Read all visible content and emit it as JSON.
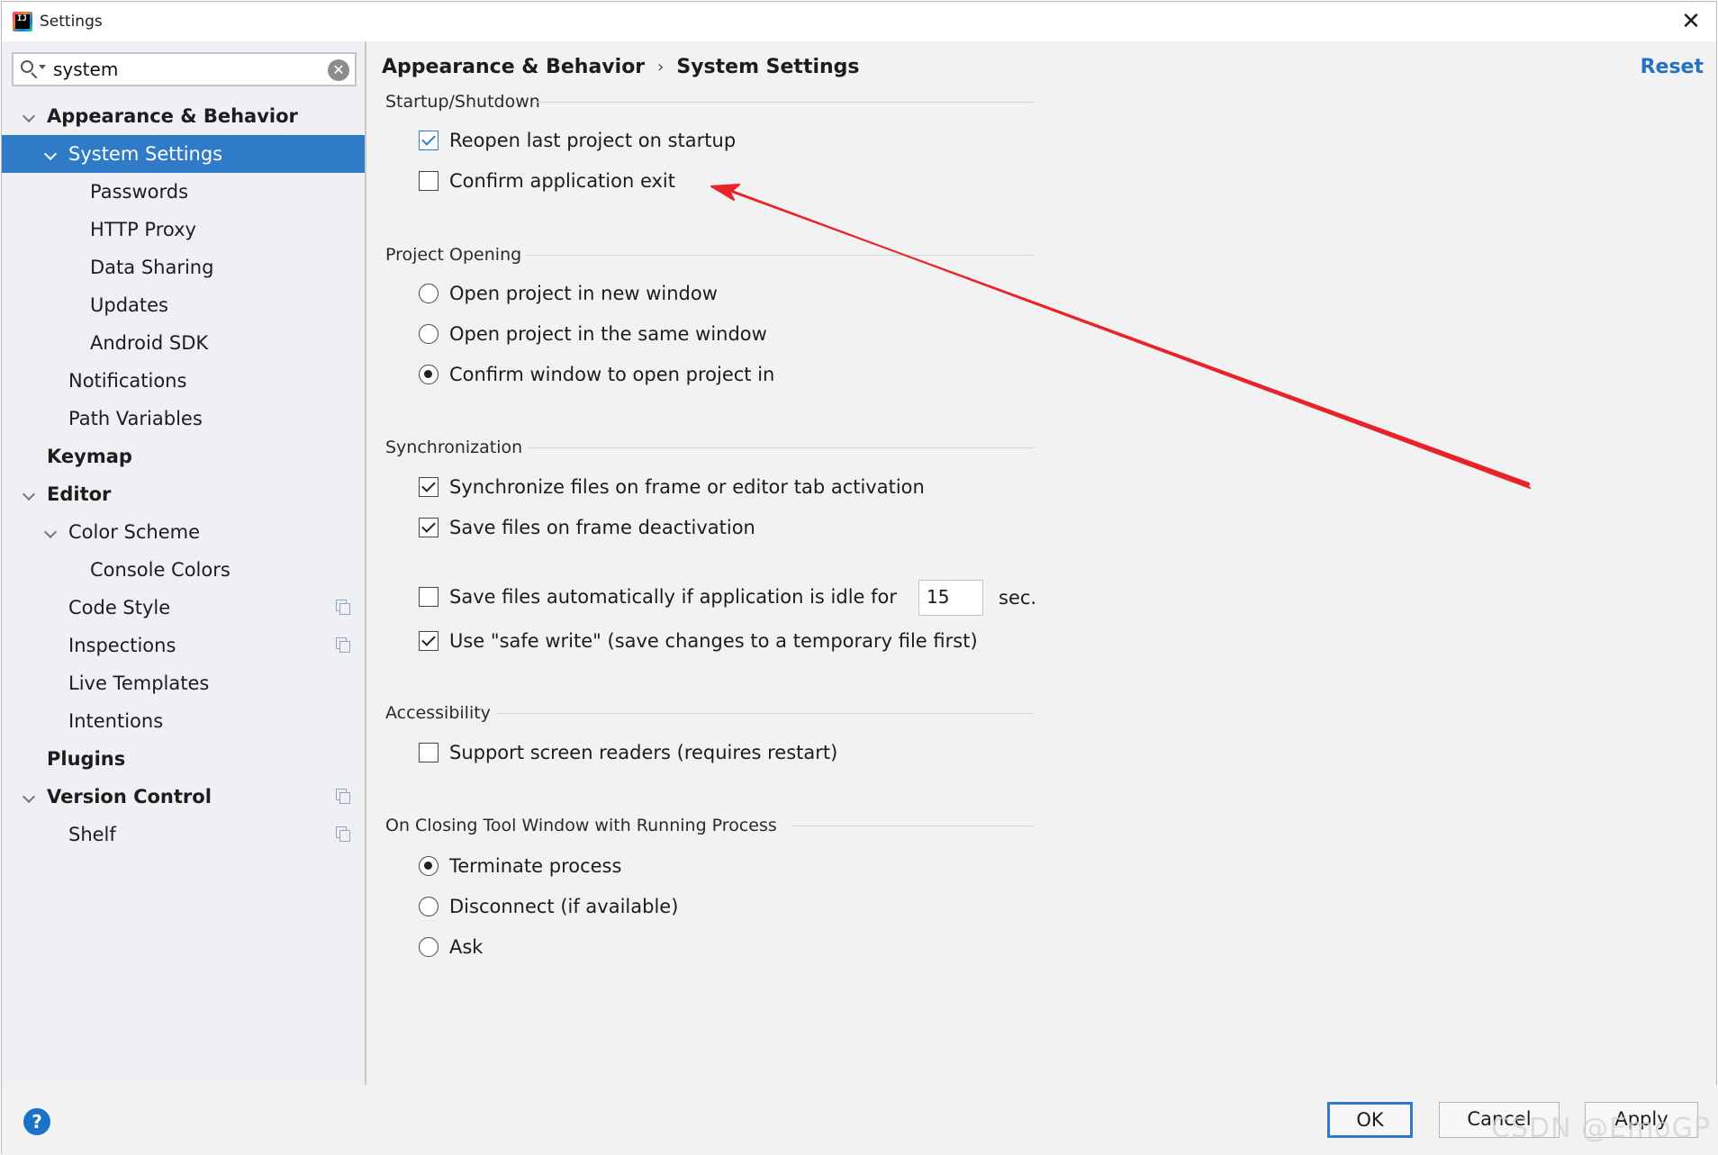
{
  "window": {
    "title": "Settings",
    "app_icon_text": "IJ",
    "close_glyph": "✕"
  },
  "search": {
    "value": "system",
    "clear_glyph": "✕"
  },
  "sidebar": {
    "items": [
      {
        "label": "Appearance & Behavior",
        "level": 0,
        "bold": true,
        "expanded": true
      },
      {
        "label": "System Settings",
        "level": 1,
        "bold": false,
        "expanded": true,
        "selected": true
      },
      {
        "label": "Passwords",
        "level": 2
      },
      {
        "label": "HTTP Proxy",
        "level": 2
      },
      {
        "label": "Data Sharing",
        "level": 2
      },
      {
        "label": "Updates",
        "level": 2
      },
      {
        "label": "Android SDK",
        "level": 2
      },
      {
        "label": "Notifications",
        "level": 1
      },
      {
        "label": "Path Variables",
        "level": 1
      },
      {
        "label": "Keymap",
        "level": 0,
        "bold": true
      },
      {
        "label": "Editor",
        "level": 0,
        "bold": true,
        "expanded": true
      },
      {
        "label": "Color Scheme",
        "level": 1,
        "expanded": true
      },
      {
        "label": "Console Colors",
        "level": 2
      },
      {
        "label": "Code Style",
        "level": 1,
        "copy_icon": true
      },
      {
        "label": "Inspections",
        "level": 1,
        "copy_icon": true
      },
      {
        "label": "Live Templates",
        "level": 1
      },
      {
        "label": "Intentions",
        "level": 1
      },
      {
        "label": "Plugins",
        "level": 0,
        "bold": true
      },
      {
        "label": "Version Control",
        "level": 0,
        "bold": true,
        "expanded": true,
        "copy_icon": true
      },
      {
        "label": "Shelf",
        "level": 1,
        "copy_icon": true
      }
    ]
  },
  "breadcrumb": {
    "parent": "Appearance & Behavior",
    "separator": "›",
    "current": "System Settings"
  },
  "reset_label": "Reset",
  "groups": {
    "startup": {
      "title": "Startup/Shutdown",
      "reopen_last_project": {
        "label": "Reopen last project on startup",
        "checked": true
      },
      "confirm_exit": {
        "label": "Confirm application exit",
        "checked": false
      }
    },
    "project_opening": {
      "title": "Project Opening",
      "new_window": {
        "label": "Open project in new window",
        "checked": false
      },
      "same_window": {
        "label": "Open project in the same window",
        "checked": false
      },
      "confirm_window": {
        "label": "Confirm window to open project in",
        "checked": true
      }
    },
    "sync": {
      "title": "Synchronization",
      "sync_files": {
        "label": "Synchronize files on frame or editor tab activation",
        "checked": true
      },
      "save_on_deactivation": {
        "label": "Save files on frame deactivation",
        "checked": true
      },
      "save_idle": {
        "label": "Save files automatically if application is idle for",
        "checked": false,
        "value": "15",
        "unit": "sec."
      },
      "safe_write": {
        "label": "Use \"safe write\" (save changes to a temporary file first)",
        "checked": true
      }
    },
    "accessibility": {
      "title": "Accessibility",
      "screen_readers": {
        "label": "Support screen readers (requires restart)",
        "checked": false
      }
    },
    "closing": {
      "title": "On Closing Tool Window with Running Process",
      "terminate": {
        "label": "Terminate process",
        "checked": true
      },
      "disconnect": {
        "label": "Disconnect (if available)",
        "checked": false
      },
      "ask": {
        "label": "Ask",
        "checked": false
      }
    }
  },
  "footer": {
    "help_glyph": "?",
    "ok_label": "OK",
    "cancel_label": "Cancel",
    "apply_label": "Apply"
  },
  "annotation": {
    "arrow_color": "#e8232a"
  },
  "watermark": "CSDN @EmoGP"
}
